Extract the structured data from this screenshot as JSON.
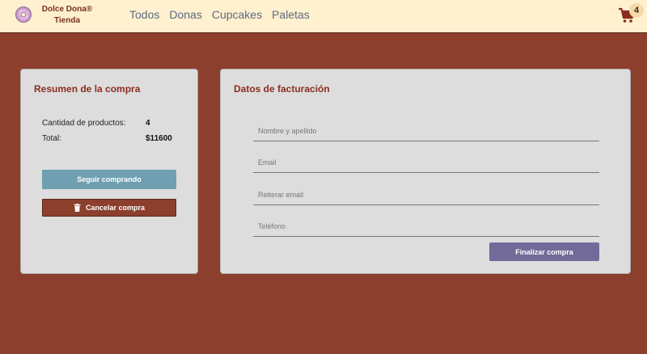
{
  "navbar": {
    "brand_line1": "Dolce Dona®",
    "brand_line2": "Tienda",
    "links": [
      "Todos",
      "Donas",
      "Cupcakes",
      "Paletas"
    ],
    "cart_count": "4"
  },
  "summary": {
    "title": "Resumen de la compra",
    "products_label": "Cantidad de productos:",
    "products_value": "4",
    "total_label": "Total:",
    "total_value": "$11600",
    "continue_button": "Seguir comprando",
    "cancel_button": "Cancelar compra"
  },
  "billing": {
    "title": "Datos de facturación",
    "name_placeholder": "Nombre y apellido",
    "email_placeholder": "Email",
    "email_confirm_placeholder": "Reiterar email",
    "phone_placeholder": "Teléfono",
    "finish_button": "Finalizar compra"
  },
  "colors": {
    "page_background": "#8b3f2c",
    "navbar_background": "#fff1cf",
    "card_background": "#dddddd",
    "title_color": "#8b2d1e",
    "continue_button": "#6f9fb0",
    "cancel_button": "#8b3f2c",
    "finish_button": "#726a98"
  },
  "icons": {
    "logo": "donut-icon",
    "cart": "shopping-cart-icon",
    "cancel": "trash-icon"
  }
}
